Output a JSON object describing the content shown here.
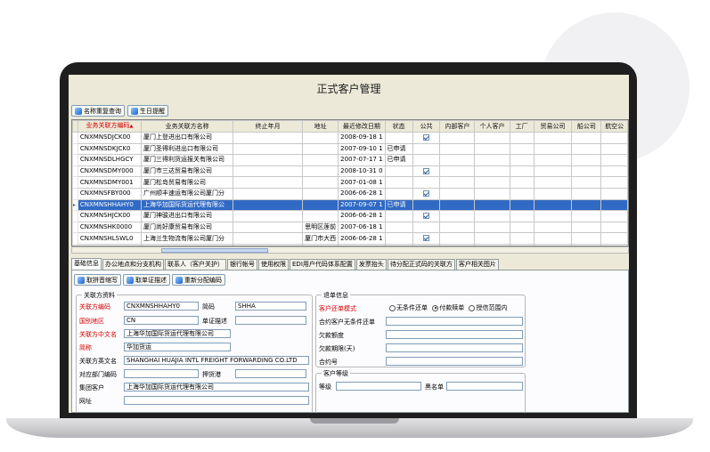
{
  "window": {
    "title": "正式客户管理"
  },
  "toolbar": {
    "name_dup_label": "名称重复查询",
    "birthday_label": "生日提醒"
  },
  "grid": {
    "headers": [
      "业务关联方编码",
      "业务关联方名称",
      "终止年月",
      "地址",
      "最近修改日期",
      "状态",
      "公共",
      "内部客户",
      "个人客户",
      "工厂",
      "贸易公司",
      "船公司",
      "航空公"
    ],
    "sort_mark": "▲",
    "rows": [
      {
        "code": "CNXMNSDJCK00",
        "name": "厦门上登进出口有限公司",
        "end": "",
        "addr": "",
        "date": "2008-09-18 1",
        "status": "",
        "public": true
      },
      {
        "code": "CNXMNSDKJCK0",
        "name": "厦门圣得利进出口有限公司",
        "end": "",
        "addr": "",
        "date": "2007-09-10 1",
        "status": "已申请",
        "public": false
      },
      {
        "code": "CNXMNSDLHGCY",
        "name": "厦门三得利货运报关有限公司",
        "end": "",
        "addr": "",
        "date": "2007-07-17 1",
        "status": "已申请",
        "public": false
      },
      {
        "code": "CNXMNSDMY000",
        "name": "厦门市三达贸易有限公司",
        "end": "",
        "addr": "",
        "date": "2008-10-31 0",
        "status": "",
        "public": true
      },
      {
        "code": "CNXMNSDMY001",
        "name": "厦门松岛贸易有限公司",
        "end": "",
        "addr": "",
        "date": "2007-01-08 1",
        "status": "",
        "public": false
      },
      {
        "code": "CNXMNSFBY000",
        "name": "广州顺丰速运有限公司厦门分",
        "end": "",
        "addr": "",
        "date": "2006-06-28 1",
        "status": "",
        "public": true
      },
      {
        "code": "CNXMNSHHAHY0",
        "name": "上海华加国际货运代理有限公",
        "end": "",
        "addr": "",
        "date": "2007-09-07 1",
        "status": "已申请",
        "public": false
      },
      {
        "code": "CNXMNSHJCK00",
        "name": "厦门神骏进出口有限公司",
        "end": "",
        "addr": "",
        "date": "2006-06-28 1",
        "status": "",
        "public": true
      },
      {
        "code": "CNXMNSHK0000",
        "name": "厦门尚好康贸易有限公司",
        "end": "",
        "addr": "思明区莲前",
        "date": "2007-06-18 1",
        "status": "",
        "public": false
      },
      {
        "code": "CNXMNSHLSWL0",
        "name": "上海兰生物流有限公司厦门分",
        "end": "",
        "addr": "厦门市大西",
        "date": "2006-06-28 1",
        "status": "",
        "public": true
      },
      {
        "code": "CNXMNSHMJCK0",
        "name": "厦门生和进出口有限公司",
        "end": "",
        "addr": "",
        "date": "2006-06-28 1",
        "status": "",
        "public": false
      }
    ],
    "selected_row": 6
  },
  "tabs": [
    "基础信息",
    "办公地点和分支机构",
    "联系人（客户关护）",
    "银行帐号",
    "使用权限",
    "EDI用户代码体系配置",
    "发票抬头",
    "待分配正式码的关联方",
    "客户相关图片"
  ],
  "active_tab": 0,
  "detail": {
    "toolbar": {
      "get_code_label": "取拼音缩写",
      "get_cert_label": "取单证描述",
      "reassign_label": "重新分配编码"
    },
    "basic": {
      "group_title": "关联方资料",
      "code_label": "关联方编码",
      "code_value": "CNXMNSHHAHY0",
      "abbr_label": "简码",
      "abbr_value": "SHHA",
      "country_label": "国别地区",
      "country_value": "CN",
      "docdesc_label": "单证描述",
      "cn_name_label": "关联方中文名",
      "cn_name_value": "上海华加国际货运代理有限公司",
      "short_label": "简称",
      "short_value": "华加货运",
      "en_name_label": "关联方英文名",
      "en_name_value": "SHANGHAI HUAJIA INTL FREIGHT FORWARDING CO.LTD",
      "dept_label": "对应部门编码",
      "customs_label": "押货港",
      "group_label": "集团客户",
      "group_value": "上海华加国际货运代理有限公司",
      "url_label": "网址"
    },
    "return": {
      "group_title": "退单信息",
      "mode_label": "客户还单模式",
      "opt_none": "无条件还单",
      "opt_paid": "付款赎单",
      "opt_scope": "授信范围内",
      "contract_label": "合约客户无条件还单",
      "arrears_label": "欠款额度",
      "period_label": "欠款期限(天)",
      "contract_no_label": "合约号"
    },
    "grade": {
      "group_title": "客户等级",
      "level_label": "等级",
      "blacklist_label": "黑名单"
    }
  }
}
